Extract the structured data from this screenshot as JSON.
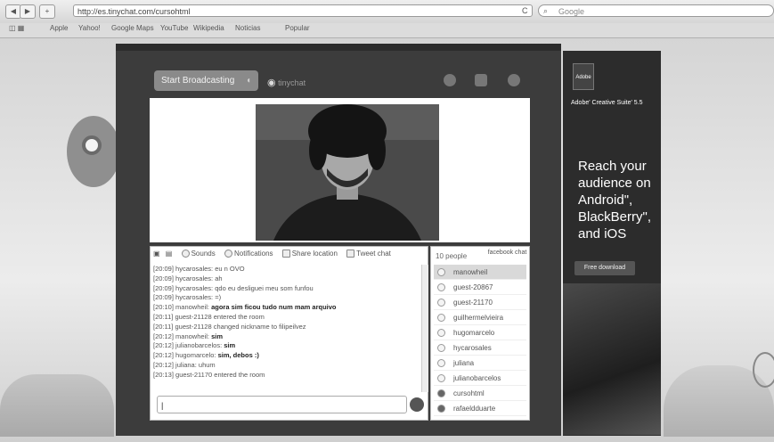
{
  "browser": {
    "url": "http://es.tinychat.com/cursohtml",
    "search_placeholder": "Google",
    "reload_label": "C",
    "bookmarks": [
      "Apple",
      "Yahoo!",
      "Google Maps",
      "YouTube",
      "Wikipedia",
      "Noticias",
      "Popular"
    ]
  },
  "app": {
    "start_button": "Start Broadcasting",
    "logo": "tinychat",
    "chat_options": [
      "Sounds",
      "Notifications",
      "Share location",
      "Tweet chat"
    ],
    "people_count": "10 people",
    "facebook_label": "facebook chat",
    "messages": [
      {
        "time": "[20:09]",
        "user": "hycarosales:",
        "text": "eu n OVO",
        "bold": false
      },
      {
        "time": "[20:09]",
        "user": "hycarosales:",
        "text": "ah",
        "bold": false
      },
      {
        "time": "[20:09]",
        "user": "hycarosales:",
        "text": "qdo eu desliguei meu som funfou",
        "bold": false
      },
      {
        "time": "[20:09]",
        "user": "hycarosales:",
        "text": "=)",
        "bold": false
      },
      {
        "time": "[20:10]",
        "user": "manowheil:",
        "text": "agora sim ficou tudo num mam arquivo",
        "bold": true
      },
      {
        "time": "[20:11]",
        "user": "guest-21128",
        "text": "entered the room",
        "bold": false
      },
      {
        "time": "[20:11]",
        "user": "guest-21128",
        "text": "changed nickname to filipeilvez",
        "bold": false
      },
      {
        "time": "[20:12]",
        "user": "manowheil:",
        "text": "sim",
        "bold": true
      },
      {
        "time": "[20:12]",
        "user": "julianobarcelos:",
        "text": "sim",
        "bold": true
      },
      {
        "time": "[20:12]",
        "user": "hugomarcelo:",
        "text": "sim, debos :)",
        "bold": true
      },
      {
        "time": "[20:12]",
        "user": "juliana:",
        "text": "uhum",
        "bold": false
      },
      {
        "time": "[20:13]",
        "user": "guest-21170",
        "text": "entered the room",
        "bold": false
      }
    ],
    "users": [
      "manowheil",
      "guest-20867",
      "guest-21170",
      "guilhermelvieira",
      "hugomarcelo",
      "hycarosales",
      "juliana",
      "julianobarcelos",
      "cursohtml",
      "rafaeldduarte"
    ]
  },
  "ad": {
    "brand": "Adobe",
    "product": "Adobe' Creative Suite' 5.5",
    "headline": "Reach your audience on Android\", BlackBerry\", and iOS",
    "button": "Free download"
  }
}
